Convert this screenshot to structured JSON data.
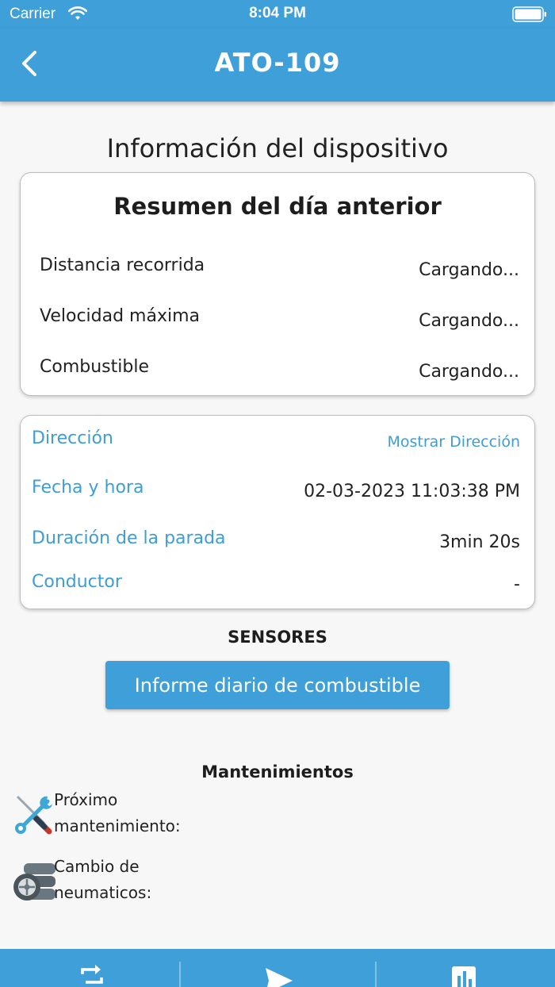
{
  "status_bar": {
    "carrier": "Carrier",
    "time": "8:04 PM"
  },
  "header": {
    "title": "ATO-109"
  },
  "page": {
    "title": "Información del dispositivo"
  },
  "summary": {
    "title": "Resumen del día anterior",
    "rows": [
      {
        "label": "Distancia recorrida",
        "value": "Cargando..."
      },
      {
        "label": "Velocidad máxima",
        "value": "Cargando..."
      },
      {
        "label": "Combustible",
        "value": "Cargando..."
      }
    ]
  },
  "info": {
    "address_label": "Dirección",
    "address_link": "Mostrar Dirección",
    "datetime_label": "Fecha y hora",
    "datetime_value": "02-03-2023 11:03:38 PM",
    "stop_label": "Duración de la parada",
    "stop_value": "3min 20s",
    "driver_label": "Conductor",
    "driver_value": "-"
  },
  "sensors": {
    "title": "SENSORES",
    "fuel_button": "Informe diario de combustible"
  },
  "maintenance": {
    "title": "Mantenimientos",
    "items": [
      {
        "line1": "Próximo",
        "line2": "mantenimiento:",
        "icon": "tools-icon"
      },
      {
        "line1": "Cambio de",
        "line2": "neumaticos:",
        "icon": "tires-icon"
      }
    ]
  },
  "bottom_nav": {
    "icons": [
      "swap-icon",
      "send-icon",
      "chart-icon"
    ]
  },
  "colors": {
    "primary": "#3f9fd8",
    "link": "#3d9dd6",
    "background": "#f7f7f7"
  }
}
